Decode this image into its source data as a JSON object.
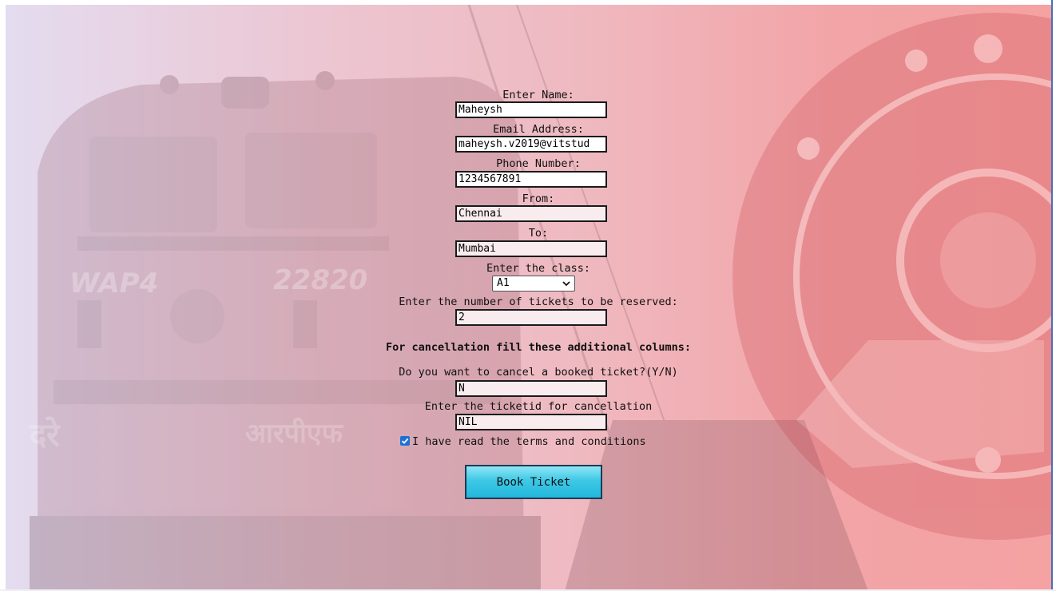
{
  "form": {
    "name_label": "Enter Name:",
    "name_value": "Maheysh",
    "email_label": "Email Address:",
    "email_value": "maheysh.v2019@vitstud",
    "phone_label": "Phone Number:",
    "phone_value": "1234567891",
    "from_label": "From:",
    "from_value": "Chennai",
    "to_label": "To:",
    "to_value": "Mumbai",
    "class_label": "Enter the class:",
    "class_value": "A1",
    "tickets_label": "Enter the number of tickets to be reserved:",
    "tickets_value": "2",
    "cancel_heading": "For cancellation fill these additional columns:",
    "cancel_question_label": "Do you want to cancel a booked ticket?(Y/N)",
    "cancel_question_value": "N",
    "ticketid_label": "Enter the ticketid for cancellation",
    "ticketid_value": "NIL",
    "terms_label": "I have read the terms and conditions",
    "terms_checked": true,
    "submit_label": "Book Ticket"
  },
  "background": {
    "locomotive_number": "22820",
    "locomotive_model": "WAP4",
    "side_text": "दरे",
    "side_text_2": "आरपीएफ"
  },
  "colors": {
    "button_accent": "#3ec8e6",
    "checkbox_accent": "#1e6fd6"
  }
}
